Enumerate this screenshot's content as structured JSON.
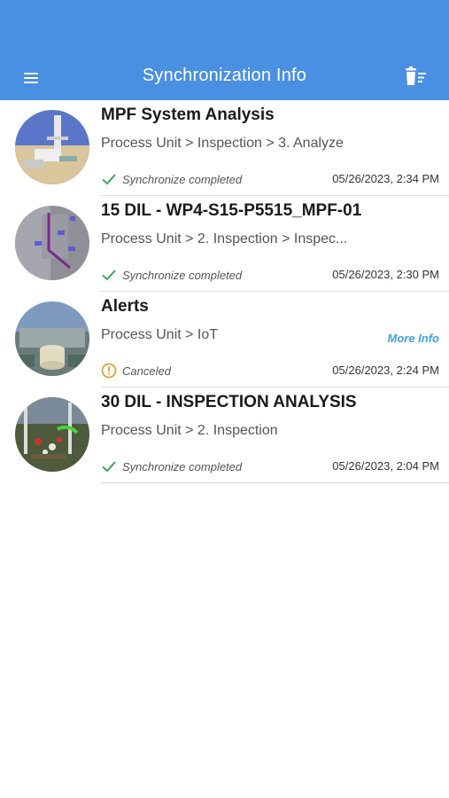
{
  "header": {
    "title": "Synchronization Info",
    "background": "#4a90e2"
  },
  "icons": {
    "menu": "hamburger-menu-icon",
    "clear": "trash-list-icon",
    "completed": "checkmark-icon",
    "canceled": "alert-circle-icon"
  },
  "colors": {
    "completed": "#3aa757",
    "canceled": "#e6a23c",
    "link": "#3d9fe0"
  },
  "items": [
    {
      "title": "MPF System Analysis",
      "path": "Process Unit > Inspection > 3. Analyze",
      "status": "Synchronize completed",
      "status_type": "completed",
      "date": "05/26/2023, 2:34 PM"
    },
    {
      "title": "15 DIL - WP4-S15-P5515_MPF-01",
      "path": "Process Unit > 2. Inspection > Inspec...",
      "status": "Synchronize completed",
      "status_type": "completed",
      "date": "05/26/2023, 2:30 PM"
    },
    {
      "title": "Alerts",
      "path": "Process Unit > IoT",
      "link": "More Info",
      "status": "Canceled",
      "status_type": "canceled",
      "date": "05/26/2023, 2:24 PM"
    },
    {
      "title": "30 DIL - INSPECTION ANALYSIS",
      "path": "Process Unit > 2. Inspection",
      "status": "Synchronize completed",
      "status_type": "completed",
      "date": "05/26/2023, 2:04 PM"
    }
  ]
}
